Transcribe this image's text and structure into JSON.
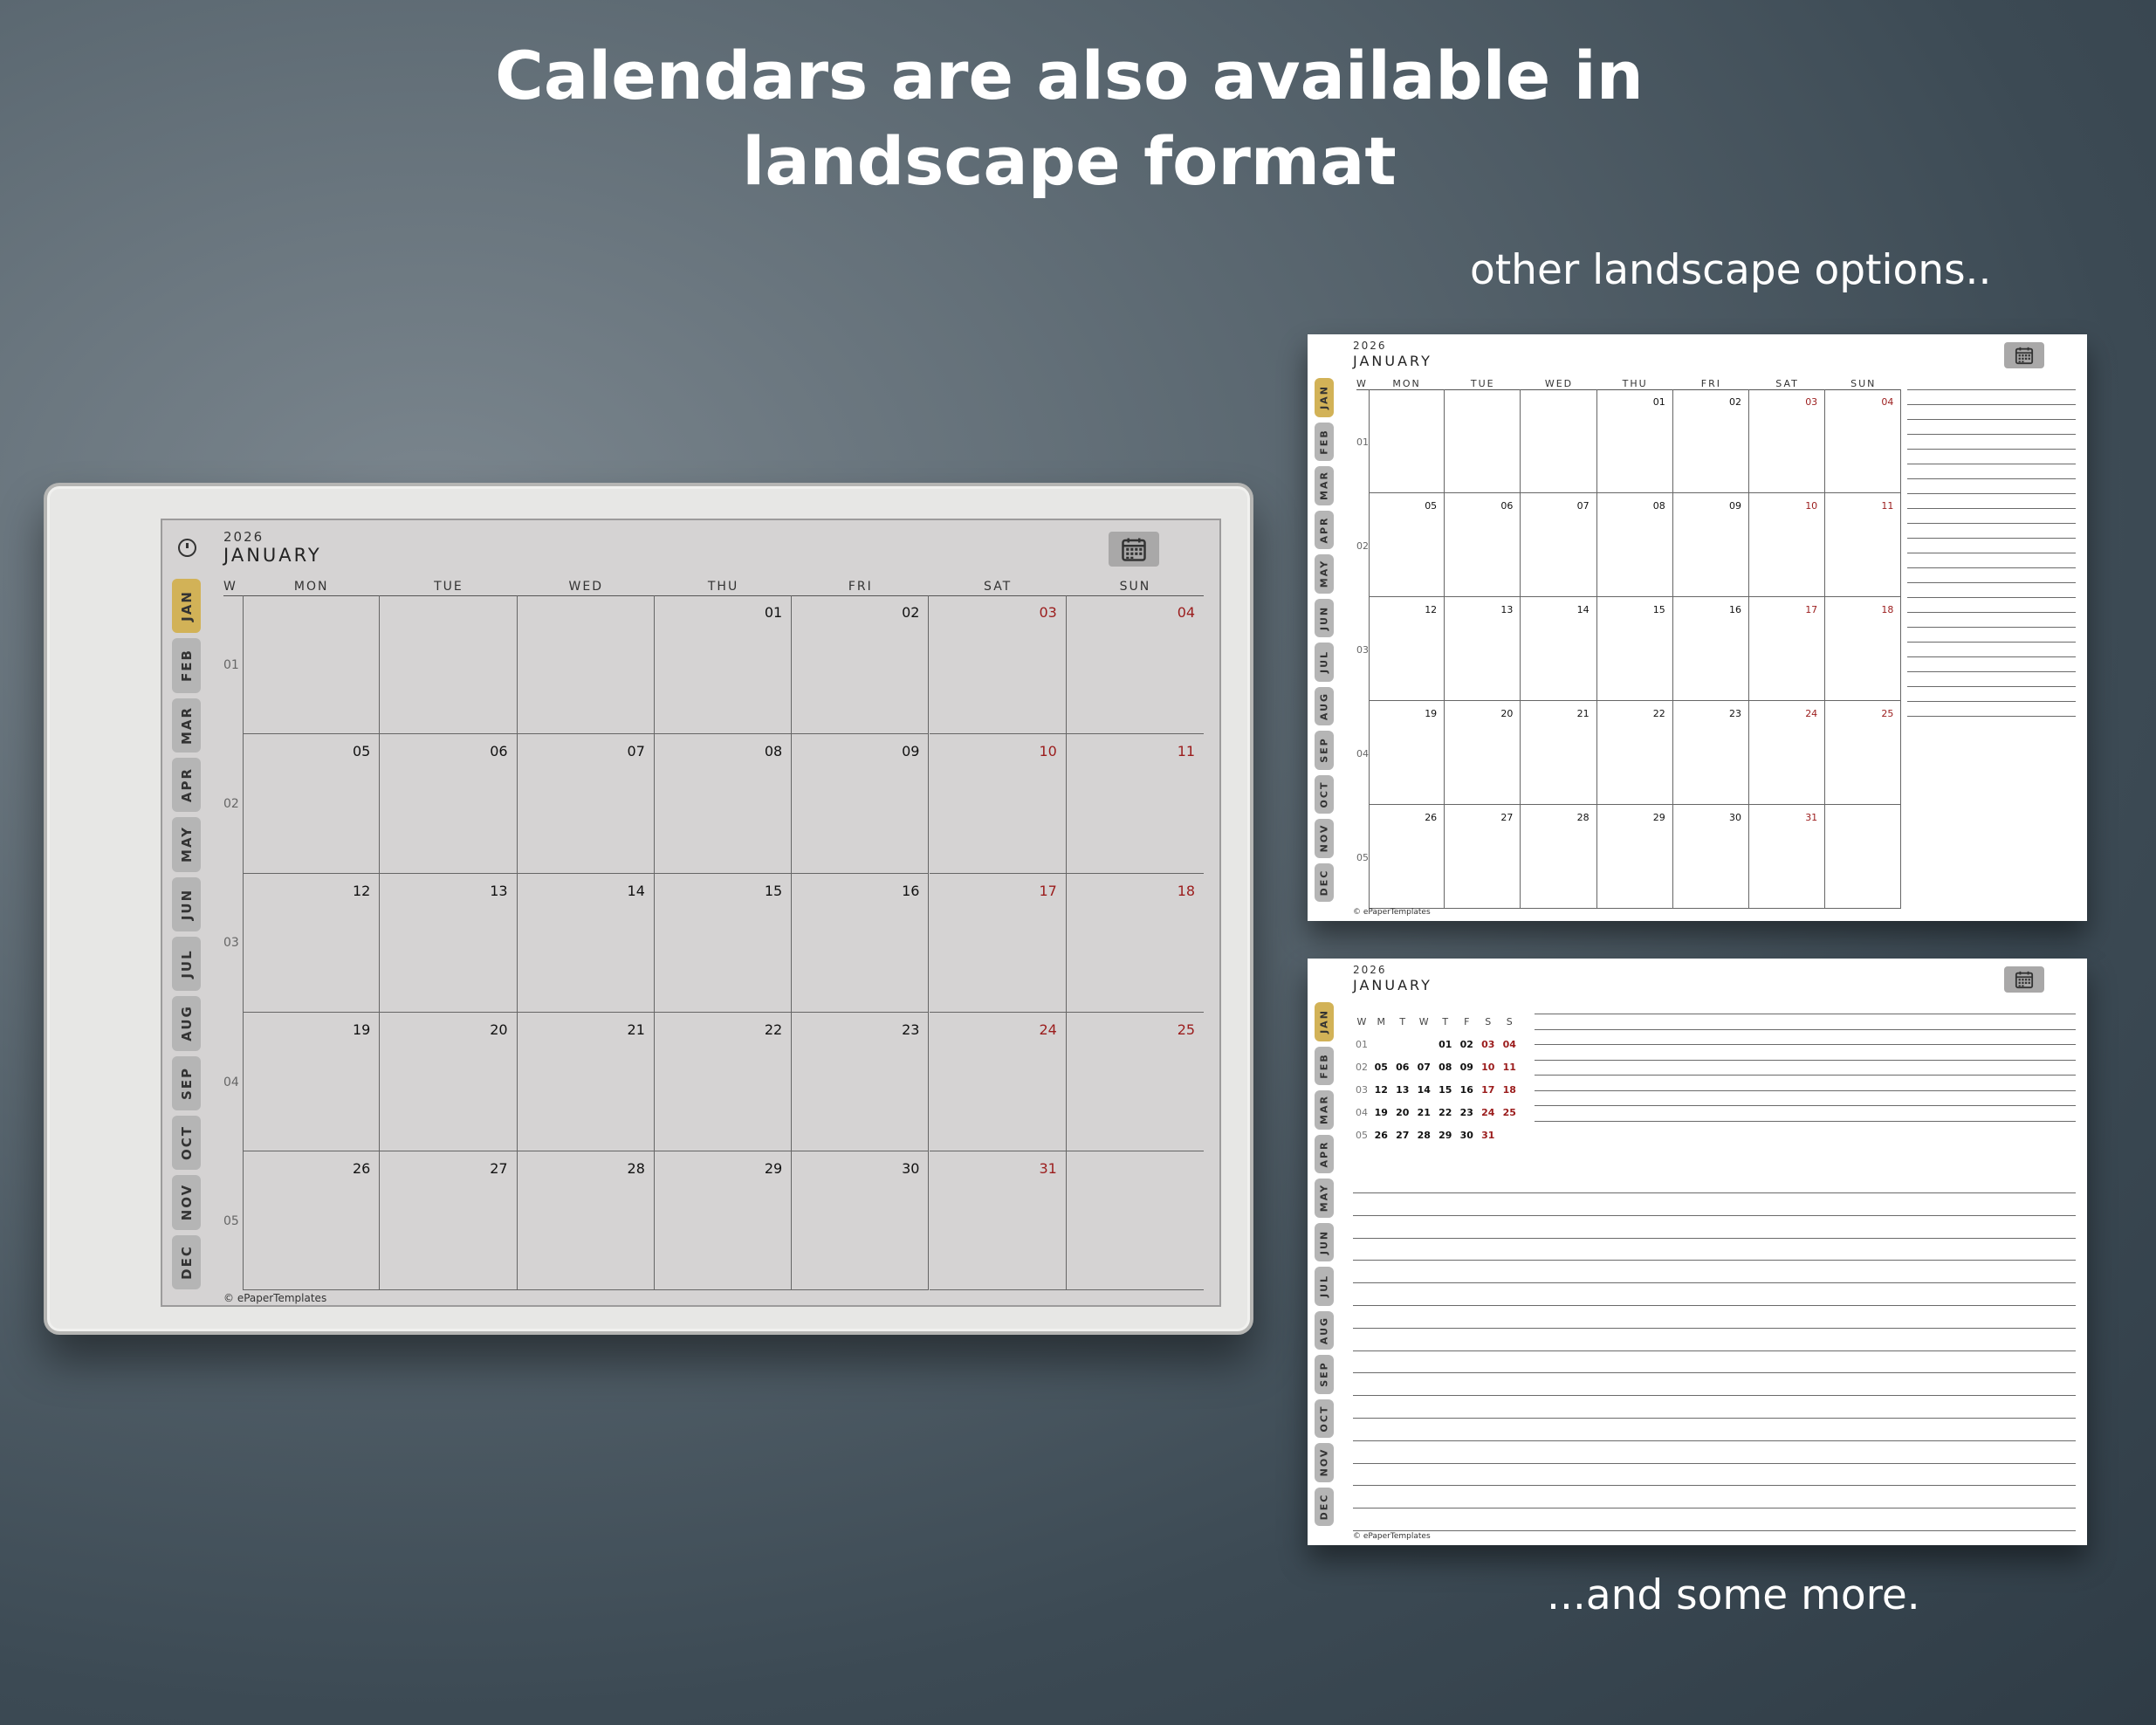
{
  "headline": {
    "line1": "Calendars are also available in",
    "line2": "landscape format"
  },
  "captions": {
    "other": "other landscape options..",
    "more": "...and some more."
  },
  "calendar": {
    "year": "2026",
    "month": "JANUARY",
    "week_label": "W",
    "weekdays": [
      "MON",
      "TUE",
      "WED",
      "THU",
      "FRI",
      "SAT",
      "SUN"
    ],
    "weeks": [
      "01",
      "02",
      "03",
      "04",
      "05"
    ],
    "grid": [
      [
        "",
        "",
        "",
        "01",
        "02",
        "03",
        "04"
      ],
      [
        "05",
        "06",
        "07",
        "08",
        "09",
        "10",
        "11"
      ],
      [
        "12",
        "13",
        "14",
        "15",
        "16",
        "17",
        "18"
      ],
      [
        "19",
        "20",
        "21",
        "22",
        "23",
        "24",
        "25"
      ],
      [
        "26",
        "27",
        "28",
        "29",
        "30",
        "31",
        ""
      ]
    ],
    "mini_weekdays": [
      "M",
      "T",
      "W",
      "T",
      "F",
      "S",
      "S"
    ],
    "months": [
      "JAN",
      "FEB",
      "MAR",
      "APR",
      "MAY",
      "JUN",
      "JUL",
      "AUG",
      "SEP",
      "OCT",
      "NOV",
      "DEC"
    ],
    "active_month": "JAN",
    "copyright": "© ePaperTemplates"
  },
  "colors": {
    "weekend": "#9b1c1c",
    "active_tab": "#d2b257",
    "tab": "#b5b5b5"
  },
  "icons": {
    "calendar_button": "calendar-icon",
    "device_button": "clock-dial-icon"
  }
}
